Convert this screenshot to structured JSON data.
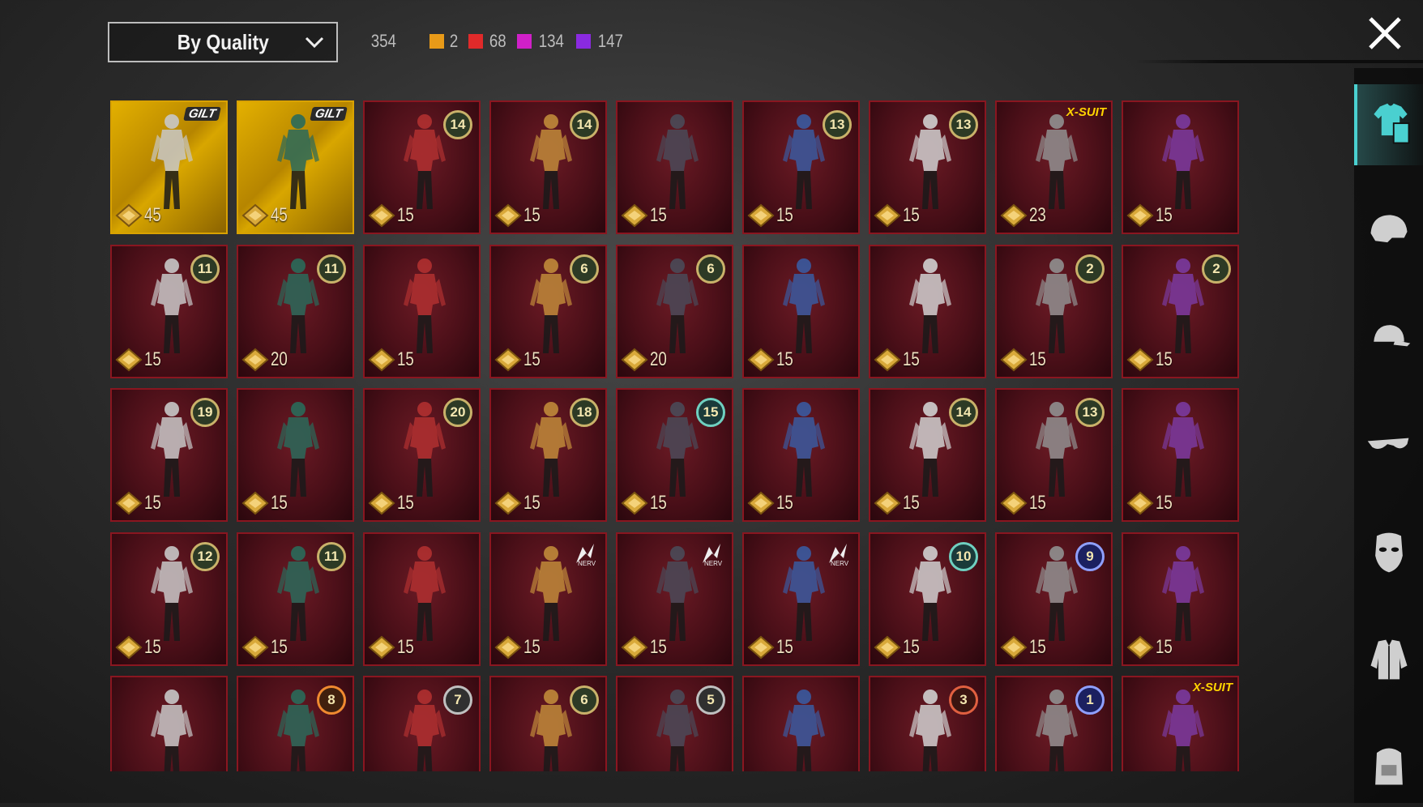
{
  "filter": {
    "sort_label": "By Quality"
  },
  "counts": {
    "total": "354",
    "by_color": [
      {
        "color": "#e89a18",
        "value": "2"
      },
      {
        "color": "#e02a2a",
        "value": "68"
      },
      {
        "color": "#d020c8",
        "value": "134"
      },
      {
        "color": "#8a2ae0",
        "value": "147"
      }
    ]
  },
  "icons": {
    "close": "close-icon",
    "sort_chevron": "chevron-down-icon",
    "coin": "gold-coin-icon"
  },
  "sidebar": {
    "items": [
      "outfit-icon",
      "helmet-icon",
      "cap-icon",
      "glasses-icon",
      "mask-icon",
      "jacket-icon",
      "backpack-icon"
    ]
  },
  "cards": [
    {
      "price": "45",
      "tier": "gold",
      "tag": "GILT"
    },
    {
      "price": "45",
      "tier": "gold",
      "tag": "GILT"
    },
    {
      "price": "15",
      "tier": "red",
      "badge": "14"
    },
    {
      "price": "15",
      "tier": "red",
      "badge": "14"
    },
    {
      "price": "15",
      "tier": "red"
    },
    {
      "price": "15",
      "tier": "red",
      "badge": "13"
    },
    {
      "price": "15",
      "tier": "red",
      "badge": "13"
    },
    {
      "price": "23",
      "tier": "red",
      "tag": "X-SUIT"
    },
    {
      "price": "15",
      "tier": "red"
    },
    {
      "price": "15",
      "tier": "red",
      "badge": "11"
    },
    {
      "price": "20",
      "tier": "red",
      "badge": "11"
    },
    {
      "price": "15",
      "tier": "red"
    },
    {
      "price": "15",
      "tier": "red",
      "badge": "6"
    },
    {
      "price": "20",
      "tier": "red",
      "badge": "6"
    },
    {
      "price": "15",
      "tier": "red"
    },
    {
      "price": "15",
      "tier": "red"
    },
    {
      "price": "15",
      "tier": "red",
      "badge": "2"
    },
    {
      "price": "15",
      "tier": "red",
      "badge": "2"
    },
    {
      "price": "15",
      "tier": "red",
      "badge": "19"
    },
    {
      "price": "15",
      "tier": "red"
    },
    {
      "price": "15",
      "tier": "red",
      "badge": "20"
    },
    {
      "price": "15",
      "tier": "red",
      "badge": "18"
    },
    {
      "price": "15",
      "tier": "red",
      "badge": "15"
    },
    {
      "price": "15",
      "tier": "red"
    },
    {
      "price": "15",
      "tier": "red",
      "badge": "14"
    },
    {
      "price": "15",
      "tier": "red",
      "badge": "13"
    },
    {
      "price": "15",
      "tier": "red"
    },
    {
      "price": "15",
      "tier": "red",
      "badge": "12"
    },
    {
      "price": "15",
      "tier": "red",
      "badge": "11"
    },
    {
      "price": "15",
      "tier": "red"
    },
    {
      "price": "15",
      "tier": "red",
      "tag": "EVA"
    },
    {
      "price": "15",
      "tier": "red",
      "tag": "EVA"
    },
    {
      "price": "15",
      "tier": "red",
      "tag": "EVA"
    },
    {
      "price": "15",
      "tier": "red",
      "badge": "10"
    },
    {
      "price": "15",
      "tier": "red",
      "badge": "9"
    },
    {
      "price": "15",
      "tier": "red"
    },
    {
      "tier": "red"
    },
    {
      "tier": "red",
      "badge": "8"
    },
    {
      "tier": "red",
      "badge": "7"
    },
    {
      "tier": "red",
      "badge": "6"
    },
    {
      "tier": "red",
      "badge": "5"
    },
    {
      "tier": "red"
    },
    {
      "tier": "red",
      "badge": "3"
    },
    {
      "tier": "red",
      "badge": "1"
    },
    {
      "tier": "red",
      "tag": "X-SUIT"
    }
  ]
}
